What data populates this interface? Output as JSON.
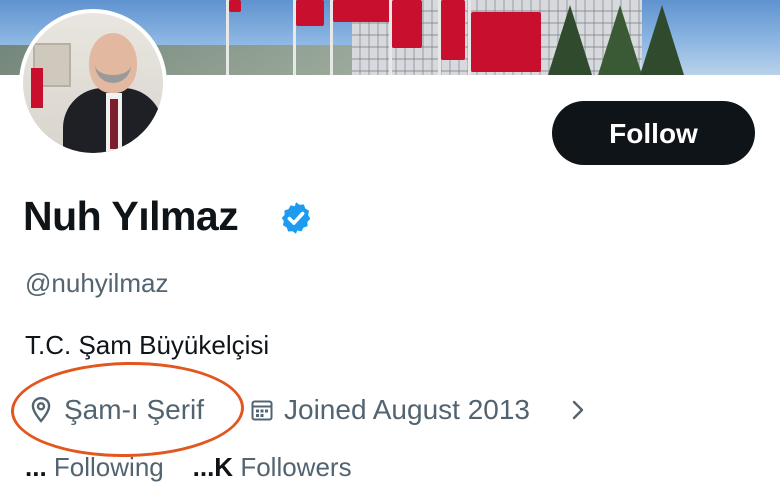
{
  "profile": {
    "name": "Nuh Yılmaz",
    "handle": "@nuhyilmaz",
    "bio": "T.C. Şam Büyükelçisi",
    "location": "Şam-ı Şerif",
    "joined": "Joined August 2013",
    "verified": true
  },
  "buttons": {
    "follow": "Follow"
  },
  "stats": {
    "following_count": "...",
    "following_label": "Following",
    "followers_count": "...K",
    "followers_label": "Followers"
  },
  "colors": {
    "text": "#0f1419",
    "secondary": "#536471",
    "verified": "#1d9bf0",
    "highlight": "#e2561f",
    "button_bg": "#0f1419"
  },
  "icons": {
    "verified": "verified-badge-icon",
    "location": "location-pin-icon",
    "calendar": "calendar-icon",
    "chevron": "chevron-right-icon"
  }
}
